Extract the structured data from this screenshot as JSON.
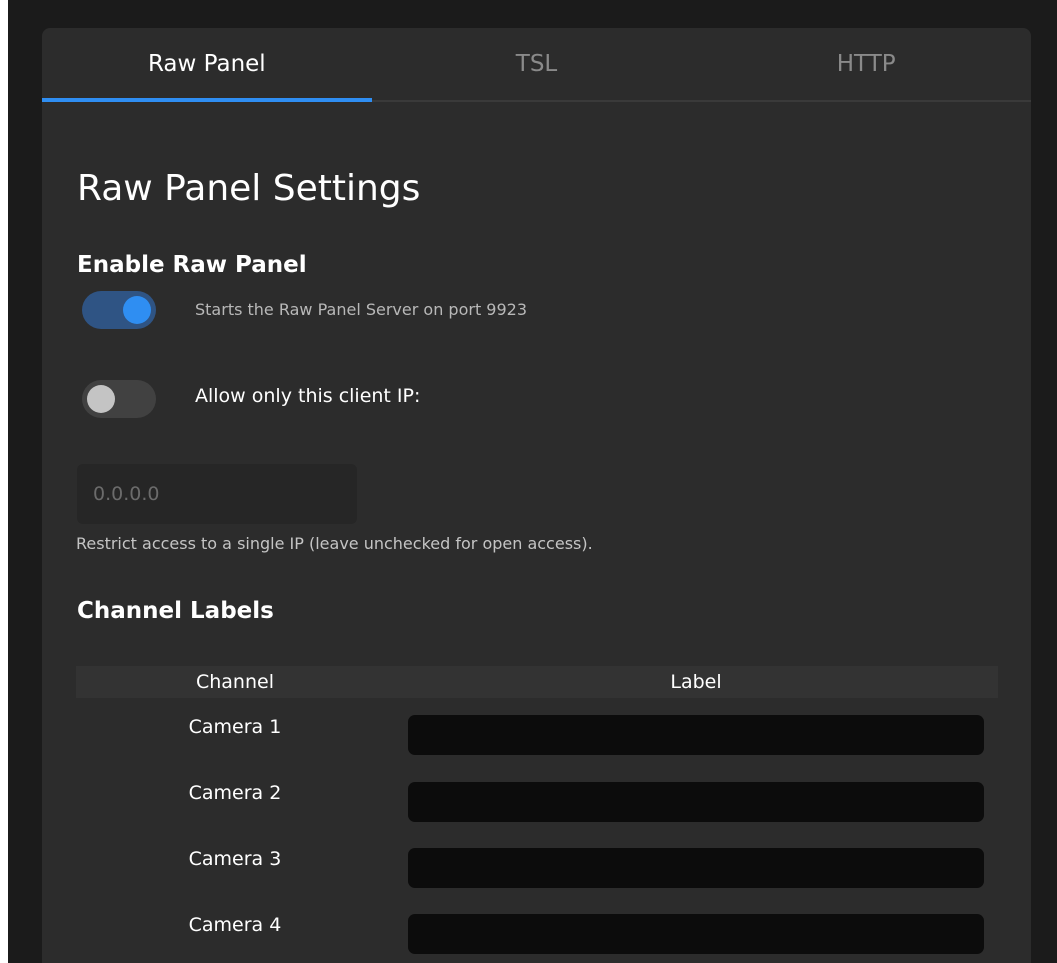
{
  "tabs": [
    {
      "label": "Raw Panel",
      "active": true
    },
    {
      "label": "TSL",
      "active": false
    },
    {
      "label": "HTTP",
      "active": false
    }
  ],
  "settings": {
    "title": "Raw Panel Settings",
    "enable_section": "Enable Raw Panel",
    "enable_toggle": {
      "on": true,
      "description": "Starts the Raw Panel Server on port 9923"
    },
    "client_ip_toggle": {
      "on": false,
      "label": "Allow only this client IP:"
    },
    "ip_field": {
      "value": "",
      "placeholder": "0.0.0.0"
    },
    "ip_help": "Restrict access to a single IP (leave unchecked for open access)."
  },
  "channel_labels": {
    "title": "Channel Labels",
    "columns": [
      "Channel",
      "Label"
    ],
    "rows": [
      {
        "channel": "Camera 1",
        "label": ""
      },
      {
        "channel": "Camera 2",
        "label": ""
      },
      {
        "channel": "Camera 3",
        "label": ""
      },
      {
        "channel": "Camera 4",
        "label": ""
      }
    ]
  },
  "colors": {
    "accent": "#2f8ef2",
    "background": "#2c2c2c",
    "input_dark": "#0c0c0c"
  }
}
